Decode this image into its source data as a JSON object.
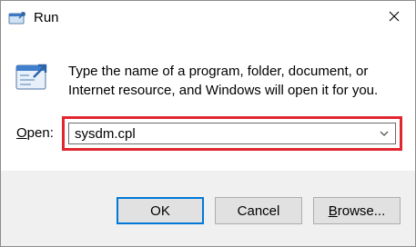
{
  "window": {
    "title": "Run",
    "close_glyph": "✕"
  },
  "icons": {
    "title_icon": "run-icon",
    "app_icon": "run-app-icon",
    "close_icon": "close-icon",
    "dropdown_icon": "chevron-down-icon"
  },
  "dialog": {
    "description": "Type the name of a program, folder, document, or Internet resource, and Windows will open it for you.",
    "open_label_accel": "O",
    "open_label_rest": "pen:",
    "input_value": "sysdm.cpl"
  },
  "buttons": {
    "ok": "OK",
    "cancel": "Cancel",
    "browse_accel": "B",
    "browse_rest": "rowse..."
  },
  "colors": {
    "highlight": "#e0272f",
    "default_button_border": "#0078d7",
    "footer_background": "#f0f0f0"
  }
}
